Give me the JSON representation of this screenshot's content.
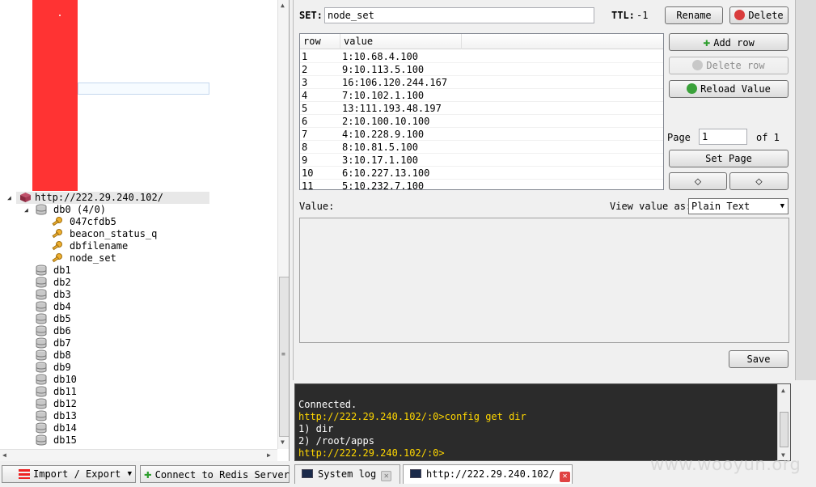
{
  "tree": {
    "server": "http://222.29.240.102/",
    "db0": {
      "label": "db0 (4/0)",
      "keys": [
        "047cfdb5",
        "beacon_status_q",
        "dbfilename",
        "node_set"
      ]
    },
    "dbs": [
      "db1",
      "db2",
      "db3",
      "db4",
      "db5",
      "db6",
      "db7",
      "db8",
      "db9",
      "db10",
      "db11",
      "db12",
      "db13",
      "db14",
      "db15"
    ]
  },
  "bottom_buttons": {
    "import_export": "Import / Export",
    "connect": "Connect to Redis Server"
  },
  "key_view": {
    "type_label": "SET:",
    "key_name": "node_set",
    "ttl_label": "TTL:",
    "ttl_value": "-1",
    "rename": "Rename",
    "delete": "Delete",
    "add_row": "Add row",
    "delete_row": "Delete row",
    "reload_value": "Reload Value",
    "page_label": "Page",
    "page_value": "1",
    "of_label": "of 1",
    "set_page": "Set Page",
    "prev_page": "⬦",
    "next_page": "⬦",
    "value_label": "Value:",
    "view_as_label": "View value as:",
    "view_as_value": "Plain Text",
    "save": "Save"
  },
  "table": {
    "headers": [
      "row",
      "value"
    ],
    "rows": [
      [
        "1",
        "1:10.68.4.100"
      ],
      [
        "2",
        "9:10.113.5.100"
      ],
      [
        "3",
        "16:106.120.244.167"
      ],
      [
        "4",
        "7:10.102.1.100"
      ],
      [
        "5",
        "13:111.193.48.197"
      ],
      [
        "6",
        "2:10.100.10.100"
      ],
      [
        "7",
        "4:10.228.9.100"
      ],
      [
        "8",
        "8:10.81.5.100"
      ],
      [
        "9",
        "3:10.17.1.100"
      ],
      [
        "10",
        "6:10.227.13.100"
      ],
      [
        "11",
        "5:10.232.7.100"
      ]
    ]
  },
  "console": {
    "lines": [
      {
        "text": "Connected.",
        "color": "#ffffff"
      },
      {
        "text": "http://222.29.240.102/:0>config get dir",
        "color": "#ffd700"
      },
      {
        "text": "1) dir",
        "color": "#ffffff"
      },
      {
        "text": "2) /root/apps",
        "color": "#ffffff"
      },
      {
        "text": "http://222.29.240.102/:0>",
        "color": "#ffd700"
      }
    ]
  },
  "tabs": {
    "system_log": "System log",
    "server_tab": "http://222.29.240.102/"
  },
  "watermark": "www.wooyun.org",
  "colors": {
    "accent_red": "#ff3333",
    "console_bg": "#2b2b2b",
    "prompt": "#ffd700"
  }
}
